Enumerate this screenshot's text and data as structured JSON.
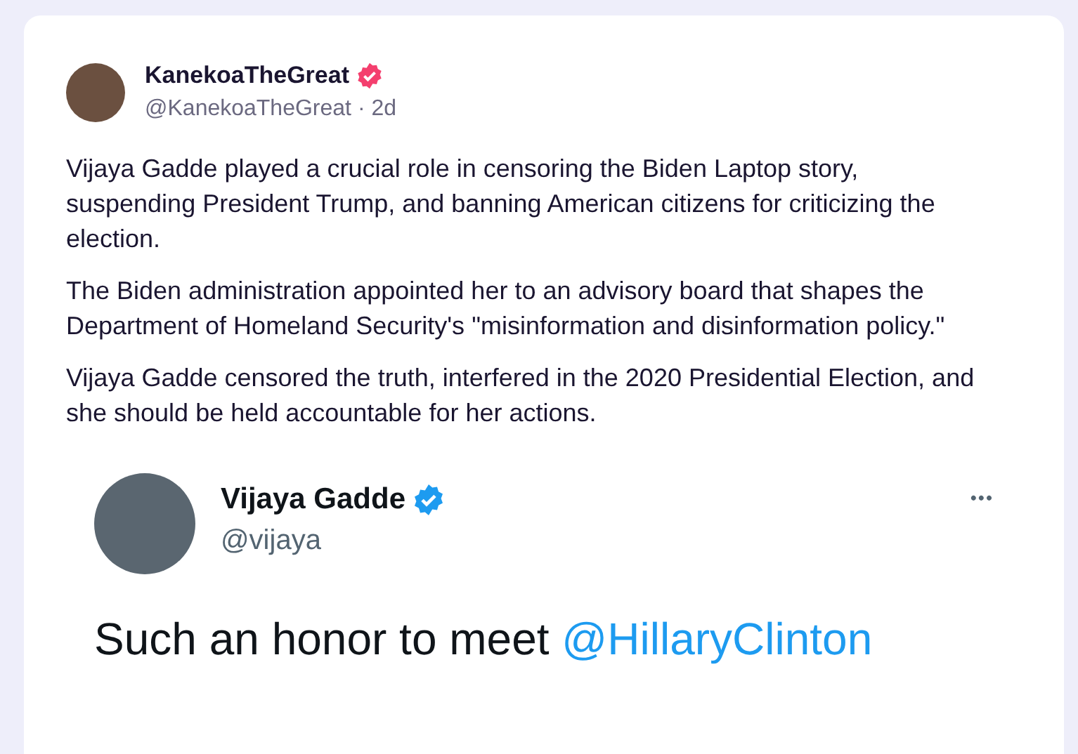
{
  "post": {
    "author": "KanekoaTheGreat",
    "verified": true,
    "handle": "@KanekoaTheGreat · 2d",
    "paragraphs": [
      "Vijaya Gadde played a crucial role in censoring the Biden Laptop story, suspending President Trump, and banning American citizens for criticizing the election.",
      "The Biden administration appointed her to an advisory board that shapes the Department of Homeland Security's \"misinformation and disinformation policy.\"",
      "Vijaya Gadde censored the truth, interfered in the 2020 Presidential Election, and she should be held accountable for her actions."
    ]
  },
  "embedded_tweet": {
    "author": "Vijaya Gadde",
    "verified": true,
    "handle": "@vijaya",
    "more": "•••",
    "text": [
      {
        "kind": "text",
        "text": "Such an honor to meet "
      },
      {
        "kind": "mention",
        "text": "@HillaryClinton"
      }
    ]
  }
}
